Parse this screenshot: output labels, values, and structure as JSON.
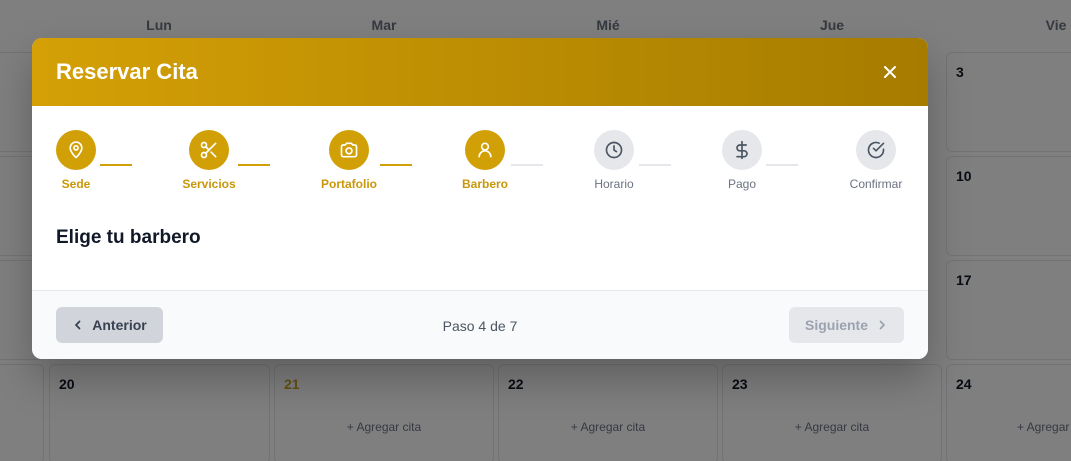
{
  "calendar": {
    "days": [
      "Lun",
      "Mar",
      "Mié",
      "Jue",
      "Vie"
    ],
    "right_column_numbers": [
      "3",
      "10",
      "17"
    ],
    "bottom_row": [
      {
        "num": "20",
        "add": ""
      },
      {
        "num": "21",
        "add": "+ Agregar cita"
      },
      {
        "num": "22",
        "add": "+ Agregar cita"
      },
      {
        "num": "23",
        "add": "+ Agregar cita"
      },
      {
        "num": "24",
        "add": "+ Agregar cita"
      }
    ]
  },
  "modal": {
    "title": "Reservar Cita",
    "close_icon": "close-icon",
    "steps": [
      {
        "label": "Sede",
        "icon": "location-pin-icon",
        "state": "active"
      },
      {
        "label": "Servicios",
        "icon": "scissors-icon",
        "state": "active"
      },
      {
        "label": "Portafolio",
        "icon": "camera-icon",
        "state": "active"
      },
      {
        "label": "Barbero",
        "icon": "user-icon",
        "state": "active"
      },
      {
        "label": "Horario",
        "icon": "clock-icon",
        "state": "inactive"
      },
      {
        "label": "Pago",
        "icon": "dollar-icon",
        "state": "inactive"
      },
      {
        "label": "Confirmar",
        "icon": "check-circle-icon",
        "state": "inactive"
      }
    ],
    "section_title": "Elige tu barbero",
    "footer": {
      "prev_label": "Anterior",
      "step_indicator": "Paso 4 de 7",
      "next_label": "Siguiente"
    }
  },
  "colors": {
    "accent": "#d19f06",
    "header_gradient_start": "#d4a006",
    "header_gradient_end": "#a67c00",
    "inactive": "#e5e7eb"
  }
}
